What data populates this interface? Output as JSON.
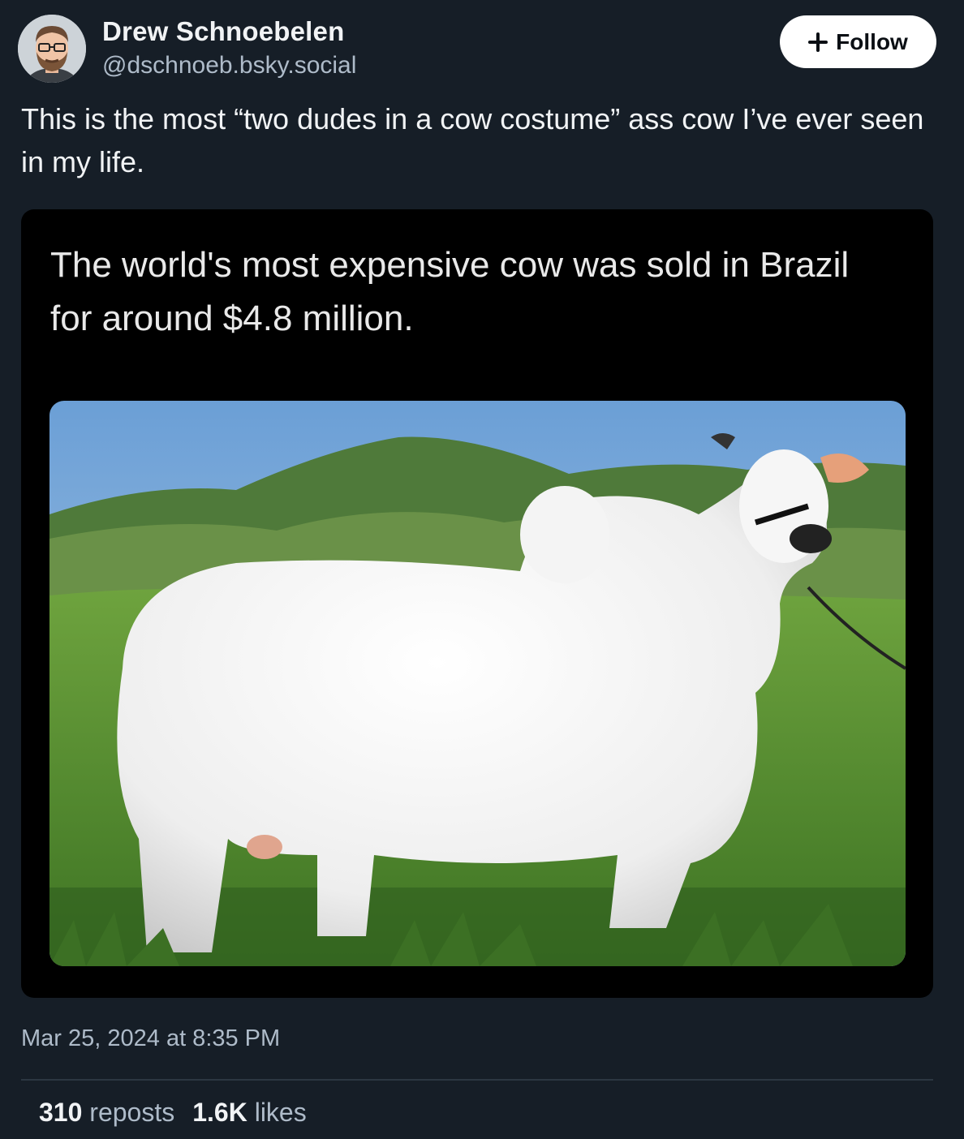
{
  "author": {
    "display_name": "Drew Schnoebelen",
    "handle": "@dschnoeb.bsky.social",
    "avatar_icon": "avatar-bearded-man-glasses"
  },
  "follow_button": {
    "label": "Follow",
    "icon": "plus-icon"
  },
  "post": {
    "text": "This is the most “two dudes in a cow costume” ass cow I’ve ever seen in my life.",
    "embed": {
      "caption": "The world's most expensive cow was sold in Brazil for around $4.8 million.",
      "photo": "white-nelore-cow-in-green-pasture"
    },
    "timestamp": "Mar 25, 2024 at 8:35 PM"
  },
  "stats": {
    "reposts_count": "310",
    "reposts_label": "reposts",
    "likes_count": "1.6K",
    "likes_label": "likes"
  },
  "colors": {
    "background": "#161e27",
    "text_primary": "#f1f3f5",
    "text_secondary": "#aebbc9",
    "embed_background": "#000000",
    "button_background": "#ffffff"
  }
}
